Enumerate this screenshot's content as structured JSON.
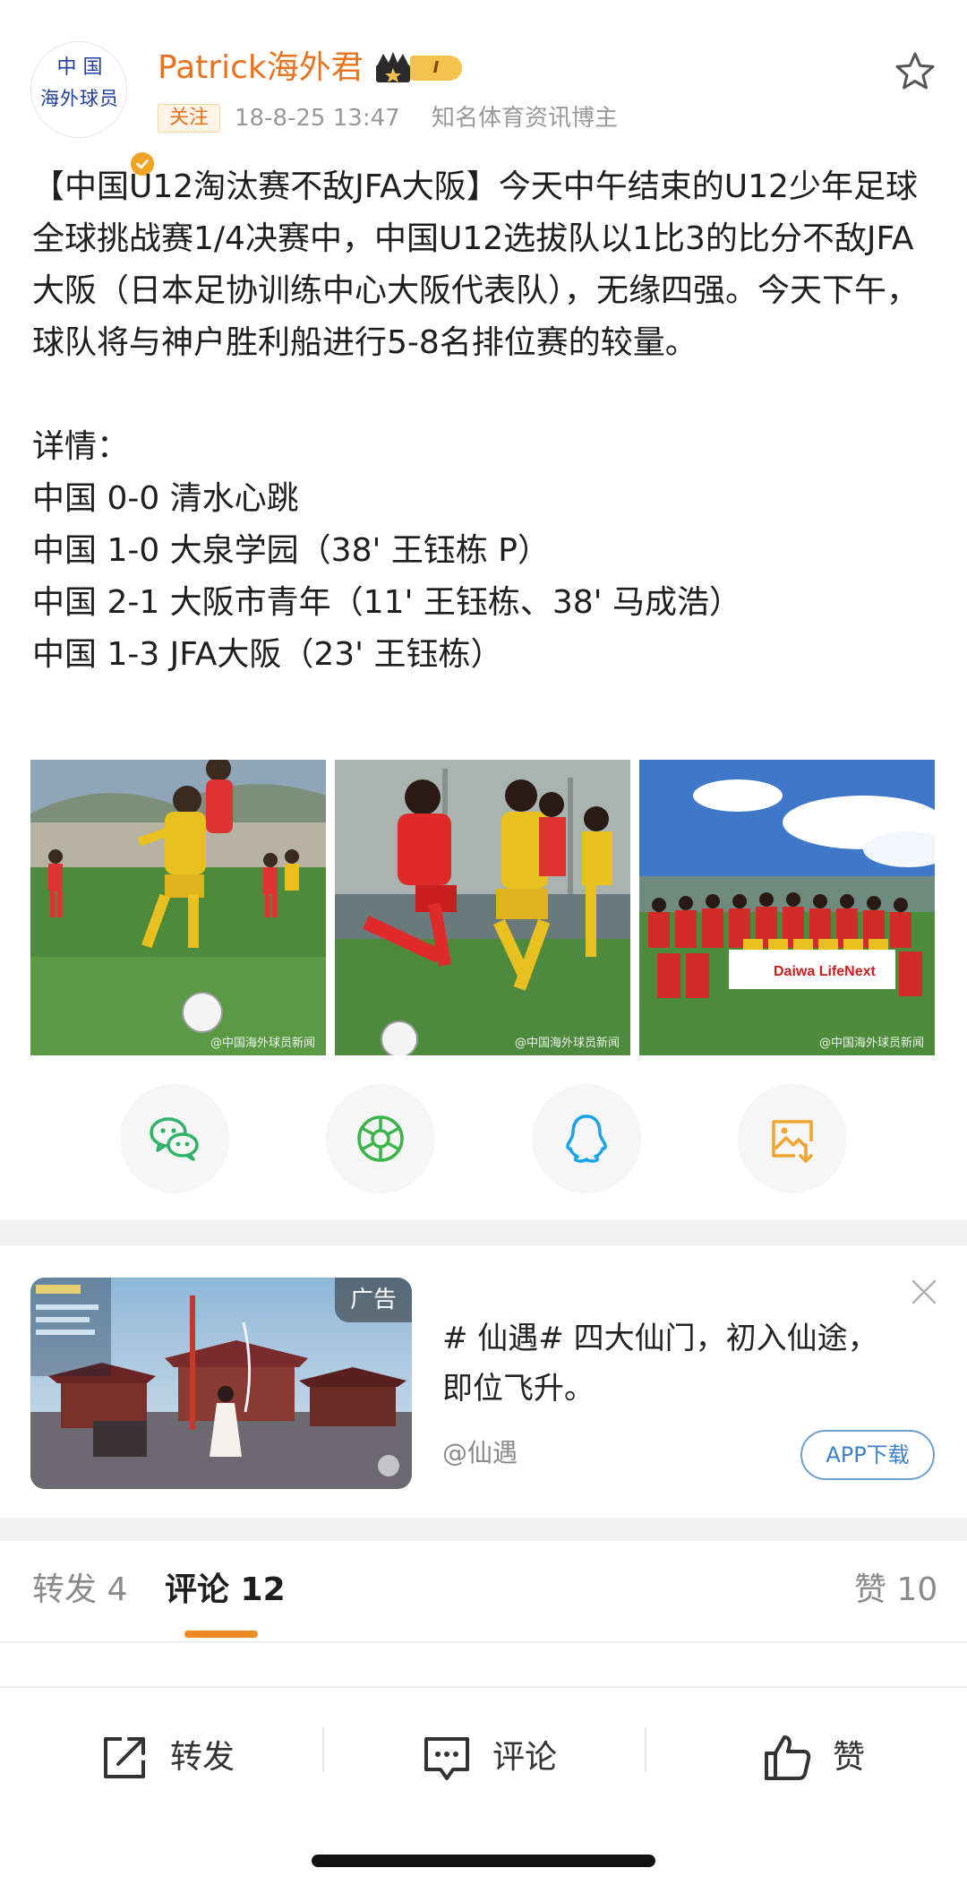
{
  "post": {
    "avatar_text_line1": "中 国",
    "avatar_text_line2": "海外球员",
    "username": "Patrick海外君",
    "level": "I",
    "follow_label": "关注",
    "time": "18-8-25 13:47",
    "role": "知名体育资讯博主",
    "body_lines": [
      "【中国U12淘汰赛不敌JFA大阪】今天中午结束的U12少年足球全球挑战赛1/4决赛中，中国U12选拔队以1比3的比分不敌JFA大阪（日本足协训练中心大阪代表队），无缘四强。今天下午，球队将与神户胜利船进行5-8名排位赛的较量。"
    ],
    "details_label": "详情：",
    "results": [
      "中国 0-0 清水心跳",
      "中国 1-0 大泉学园（38' 王钰栋 P）",
      "中国 2-1 大阪市青年（11' 王钰栋、38' 马成浩）",
      "中国 1-3 JFA大阪（23' 王钰栋）"
    ],
    "photo_watermark": "@中国海外球员新闻",
    "photo_banner": "Daiwa LifeNext"
  },
  "share": {
    "icons": [
      "wechat-icon",
      "moments-icon",
      "qq-icon",
      "save-image-icon"
    ],
    "colors": {
      "wechat": "#2fb36a",
      "moments": "#3bb54a",
      "qq": "#1aa3e8",
      "save": "#f0a531"
    }
  },
  "ad": {
    "label": "广告",
    "title": "# 仙遇# 四大仙门，初入仙途，即位飞升。",
    "advertiser": "@仙遇",
    "download": "APP下载"
  },
  "tabs": {
    "repost": "转发 4",
    "comment": "评论 12",
    "like": "赞 10"
  },
  "bottom_bar": {
    "repost": "转发",
    "comment": "评论",
    "like": "赞"
  },
  "colors": {
    "accent": "#e8731f",
    "tab_underline": "#f08a24",
    "link_blue": "#3f7fc4"
  }
}
